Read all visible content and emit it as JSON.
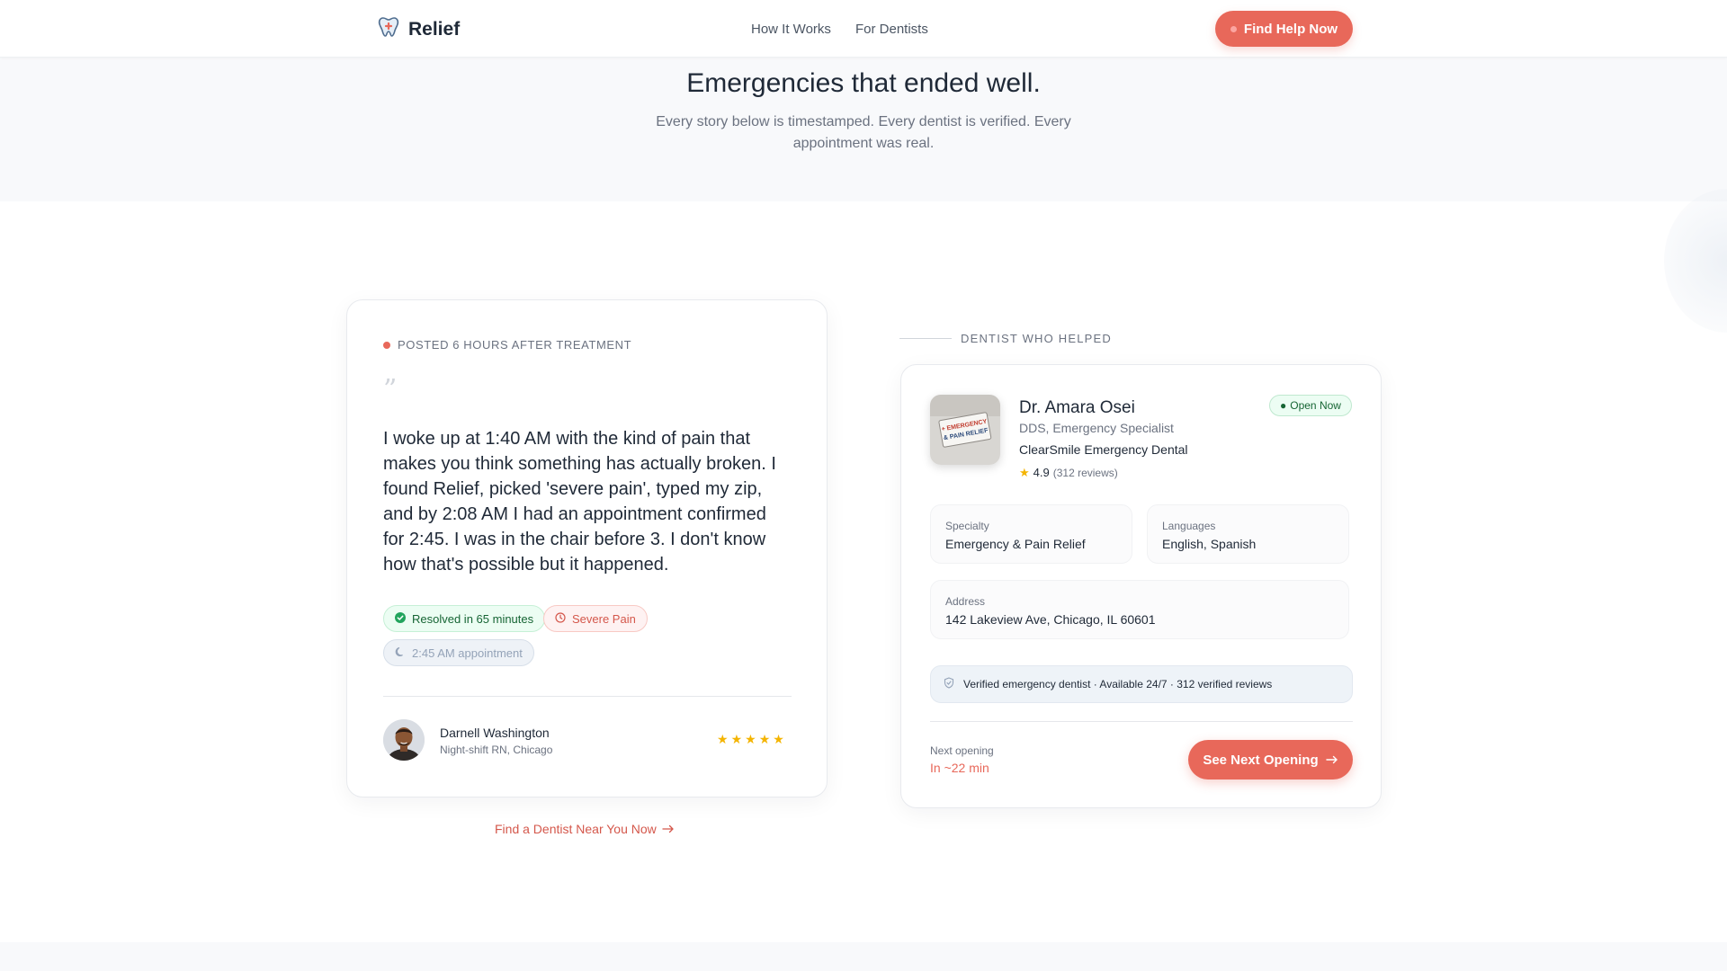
{
  "header": {
    "brand": "Relief",
    "nav": [
      "How It Works",
      "For Dentists"
    ],
    "cta": "Find Help Now"
  },
  "hero": {
    "title": "Emergencies that ended well.",
    "subtitle": "Every story below is timestamped. Every dentist is verified. Every appointment was real."
  },
  "story": {
    "posted": "POSTED 6 HOURS AFTER TREATMENT",
    "quote_mark": "”",
    "text": "I woke up at 1:40 AM with the kind of pain that makes you think something has actually broken. I found Relief, picked 'severe pain', typed my zip, and by 2:08 AM I had an appointment confirmed for 2:45. I was in the chair before 3. I don't know how that's possible but it happened.",
    "tags": {
      "resolved": "Resolved in 65 minutes",
      "pain": "Severe Pain",
      "appointment": "2:45 AM appointment"
    },
    "author": {
      "name": "Darnell Washington",
      "role": "Night-shift RN, Chicago"
    },
    "rating_stars": 5,
    "find_link": "Find a Dentist Near You Now"
  },
  "dentist": {
    "section_label": "DENTIST WHO HELPED",
    "name": "Dr. Amara Osei",
    "title": "DDS, Emergency Specialist",
    "clinic": "ClearSmile Emergency Dental",
    "rating": "4.9",
    "reviews": "(312 reviews)",
    "status": "Open Now",
    "clinic_sign": [
      "+ EMERGENCY",
      "& PAIN RELIEF"
    ],
    "specialty_label": "Specialty",
    "specialty": "Emergency & Pain Relief",
    "languages_label": "Languages",
    "languages": "English, Spanish",
    "address_label": "Address",
    "address": "142 Lakeview Ave, Chicago, IL 60601",
    "verified": "Verified emergency dentist · Available 24/7 · 312 verified reviews",
    "next_label": "Next opening",
    "next_value": "In ~22 min",
    "cta": "See Next Opening"
  },
  "colors": {
    "accent": "#e8685a",
    "green": "#166534",
    "star": "#f4b400"
  }
}
